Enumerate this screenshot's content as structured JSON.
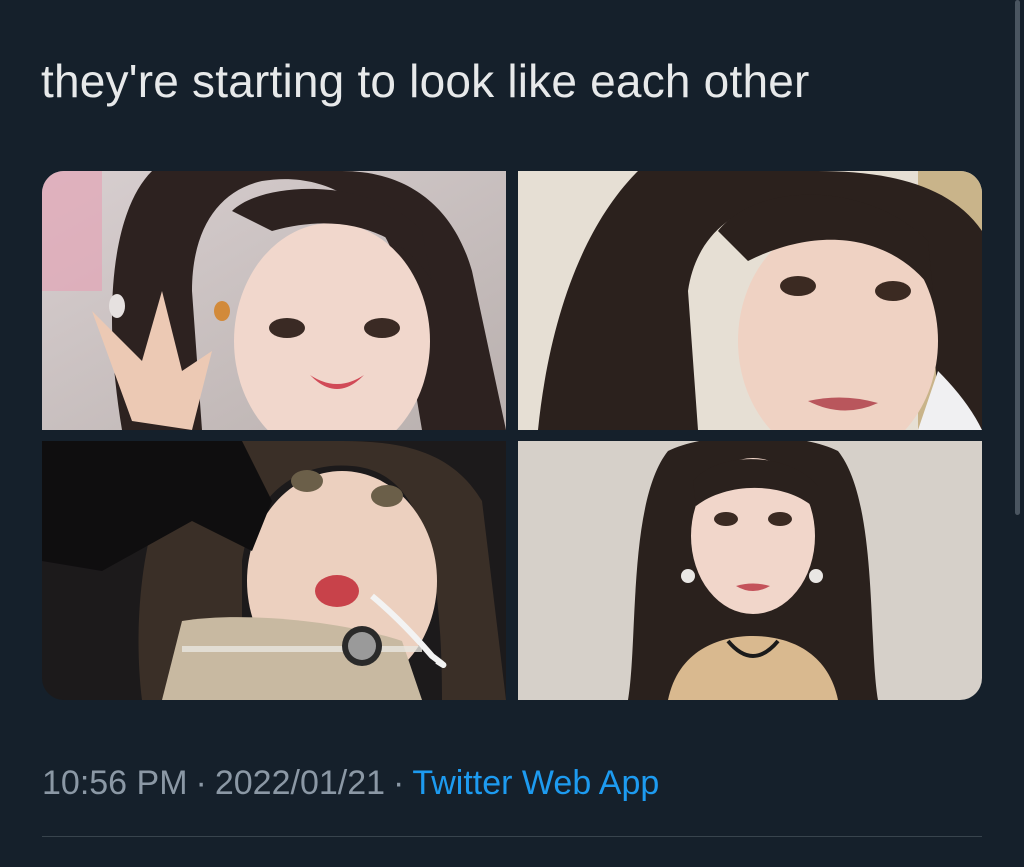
{
  "tweet": {
    "text": "they're starting to look like each other",
    "time": "10:56 PM",
    "separator": "·",
    "date": "2022/01/21",
    "source": "Twitter Web App"
  },
  "media": {
    "photos": [
      {
        "position": "top-left",
        "description": "selfie with peace sign"
      },
      {
        "position": "top-right",
        "description": "selfie with long wavy hair"
      },
      {
        "position": "bottom-left",
        "description": "selfie with black glove and headset mic"
      },
      {
        "position": "bottom-right",
        "description": "portrait with long straight hair"
      }
    ]
  },
  "colors": {
    "background": "#15202b",
    "text": "#e7e9ea",
    "muted": "#8b98a5",
    "link": "#1d9bf0",
    "divider": "#38444d"
  }
}
